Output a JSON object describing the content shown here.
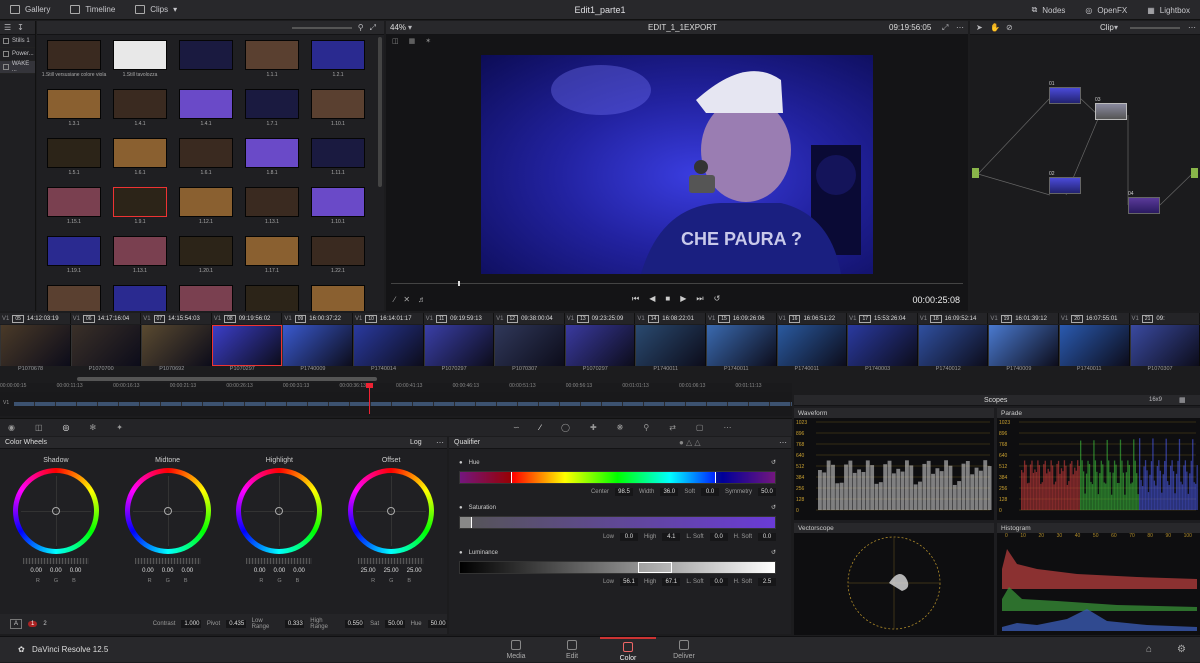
{
  "topbar": {
    "gallery": "Gallery",
    "timeline": "Timeline",
    "clips": "Clips",
    "project_title": "Edit1_parte1",
    "nodes": "Nodes",
    "openfx": "OpenFX",
    "lightbox": "Lightbox"
  },
  "sidebar": {
    "items": [
      {
        "label": "Stills 1"
      },
      {
        "label": "Power..."
      },
      {
        "label": "WAKE ..."
      }
    ]
  },
  "gallery": {
    "rows": [
      [
        "1.Still versusiane colore viola",
        "1.Still tavolozza",
        "",
        "1.1.1",
        "1.2.1"
      ],
      [
        "1.3.1",
        "1.4.1",
        "1.4.1",
        "1.7.1",
        "1.10.1"
      ],
      [
        "1.5.1",
        "1.6.1",
        "1.6.1",
        "1.8.1",
        "1.11.1"
      ],
      [
        "1.15.1",
        "1.9.1",
        "1.12.1",
        "1.13.1",
        "1.10.1"
      ],
      [
        "1.19.1",
        "1.13.1",
        "1.20.1",
        "1.17.1",
        "1.22.1"
      ],
      [
        "",
        "",
        "",
        "",
        ""
      ]
    ]
  },
  "viewer": {
    "zoom": "44%",
    "timeline_name": "EDIT_1_1EXPORT",
    "source_timecode": "09:19:56:05",
    "record_timecode": "00:00:25:08"
  },
  "nodes_panel": {
    "mode": "Clip",
    "nodes": [
      {
        "id": "01"
      },
      {
        "id": "03"
      },
      {
        "id": "02"
      },
      {
        "id": "04"
      }
    ]
  },
  "timeline": {
    "clips": [
      {
        "num": "05",
        "tc": "14:12:03:19",
        "reel": "P1070678"
      },
      {
        "num": "06",
        "tc": "14:17:16:04",
        "reel": "P1070700"
      },
      {
        "num": "07",
        "tc": "14:15:54:03",
        "reel": "P1070692"
      },
      {
        "num": "08",
        "tc": "09:19:56:02",
        "reel": "P1070297"
      },
      {
        "num": "09",
        "tc": "16:00:37:22",
        "reel": "P1740009"
      },
      {
        "num": "10",
        "tc": "16:14:01:17",
        "reel": "P1740014"
      },
      {
        "num": "11",
        "tc": "09:19:59:13",
        "reel": "P1070297"
      },
      {
        "num": "12",
        "tc": "09:38:00:04",
        "reel": "P1070307"
      },
      {
        "num": "13",
        "tc": "09:23:25:09",
        "reel": "P1070297"
      },
      {
        "num": "14",
        "tc": "16:08:22:01",
        "reel": "P1740011"
      },
      {
        "num": "15",
        "tc": "16:09:26:06",
        "reel": "P1740011"
      },
      {
        "num": "16",
        "tc": "16:06:51:22",
        "reel": "P1740011"
      },
      {
        "num": "17",
        "tc": "15:53:26:04",
        "reel": "P1740003"
      },
      {
        "num": "18",
        "tc": "16:09:52:14",
        "reel": "P1740012"
      },
      {
        "num": "19",
        "tc": "16:01:39:12",
        "reel": "P1740009"
      },
      {
        "num": "20",
        "tc": "16:07:55:01",
        "reel": "P1740011"
      },
      {
        "num": "21",
        "tc": "09:",
        "reel": "P1070307"
      }
    ],
    "ruler": [
      "00:00:00:15",
      "00:00:11:13",
      "00:00:16:13",
      "00:00:21:13",
      "00:00:26:13",
      "00:00:31:13",
      "00:00:36:13",
      "00:00:41:13",
      "00:00:46:13",
      "00:00:51:13",
      "00:00:56:13",
      "00:01:01:13",
      "00:01:06:13",
      "00:01:11:13"
    ],
    "track": "V1"
  },
  "color_wheels": {
    "title": "Color Wheels",
    "mode": "Log",
    "wheels": [
      {
        "name": "Shadow",
        "r": "0.00",
        "g": "0.00",
        "b": "0.00"
      },
      {
        "name": "Midtone",
        "r": "0.00",
        "g": "0.00",
        "b": "0.00"
      },
      {
        "name": "Highlight",
        "r": "0.00",
        "g": "0.00",
        "b": "0.00"
      },
      {
        "name": "Offset",
        "r": "25.00",
        "g": "25.00",
        "b": "25.00"
      }
    ],
    "rgb_labels": [
      "R",
      "G",
      "B"
    ],
    "footer": {
      "a": "A",
      "page1": "1",
      "page2": "2",
      "contrast_label": "Contrast",
      "contrast": "1.000",
      "pivot_label": "Pivot",
      "pivot": "0.435",
      "lowrange_label": "Low Range",
      "lowrange": "0.333",
      "highrange_label": "High Range",
      "highrange": "0.550",
      "sat_label": "Sat",
      "sat": "50.00",
      "hue_label": "Hue",
      "hue": "50.00"
    }
  },
  "qualifier": {
    "title": "Qualifier",
    "hue": {
      "label": "Hue",
      "center_l": "Center",
      "center": "98.5",
      "width_l": "Width",
      "width": "36.0",
      "soft_l": "Soft",
      "soft": "0.0",
      "sym_l": "Symmetry",
      "sym": "50.0"
    },
    "saturation": {
      "label": "Saturation",
      "low_l": "Low",
      "low": "0.0",
      "high_l": "High",
      "high": "4.1",
      "lsoft_l": "L. Soft",
      "lsoft": "0.0",
      "hsoft_l": "H. Soft",
      "hsoft": "0.0"
    },
    "luminance": {
      "label": "Luminance",
      "low_l": "Low",
      "low": "56.1",
      "high_l": "High",
      "high": "67.1",
      "lsoft_l": "L. Soft",
      "lsoft": "0.0",
      "hsoft_l": "H. Soft",
      "hsoft": "2.5"
    }
  },
  "scopes": {
    "title": "Scopes",
    "layout": "16x9",
    "waveform": "Waveform",
    "parade": "Parade",
    "vectorscope": "Vectorscope",
    "histogram": "Histogram",
    "scale": [
      "1023",
      "896",
      "768",
      "640",
      "512",
      "384",
      "256",
      "128",
      "0"
    ],
    "hist_scale": [
      "0",
      "10",
      "20",
      "30",
      "40",
      "50",
      "60",
      "70",
      "80",
      "90",
      "100"
    ]
  },
  "bottom": {
    "app": "DaVinci Resolve 12.5",
    "pages": [
      "Media",
      "Edit",
      "Color",
      "Deliver"
    ]
  }
}
